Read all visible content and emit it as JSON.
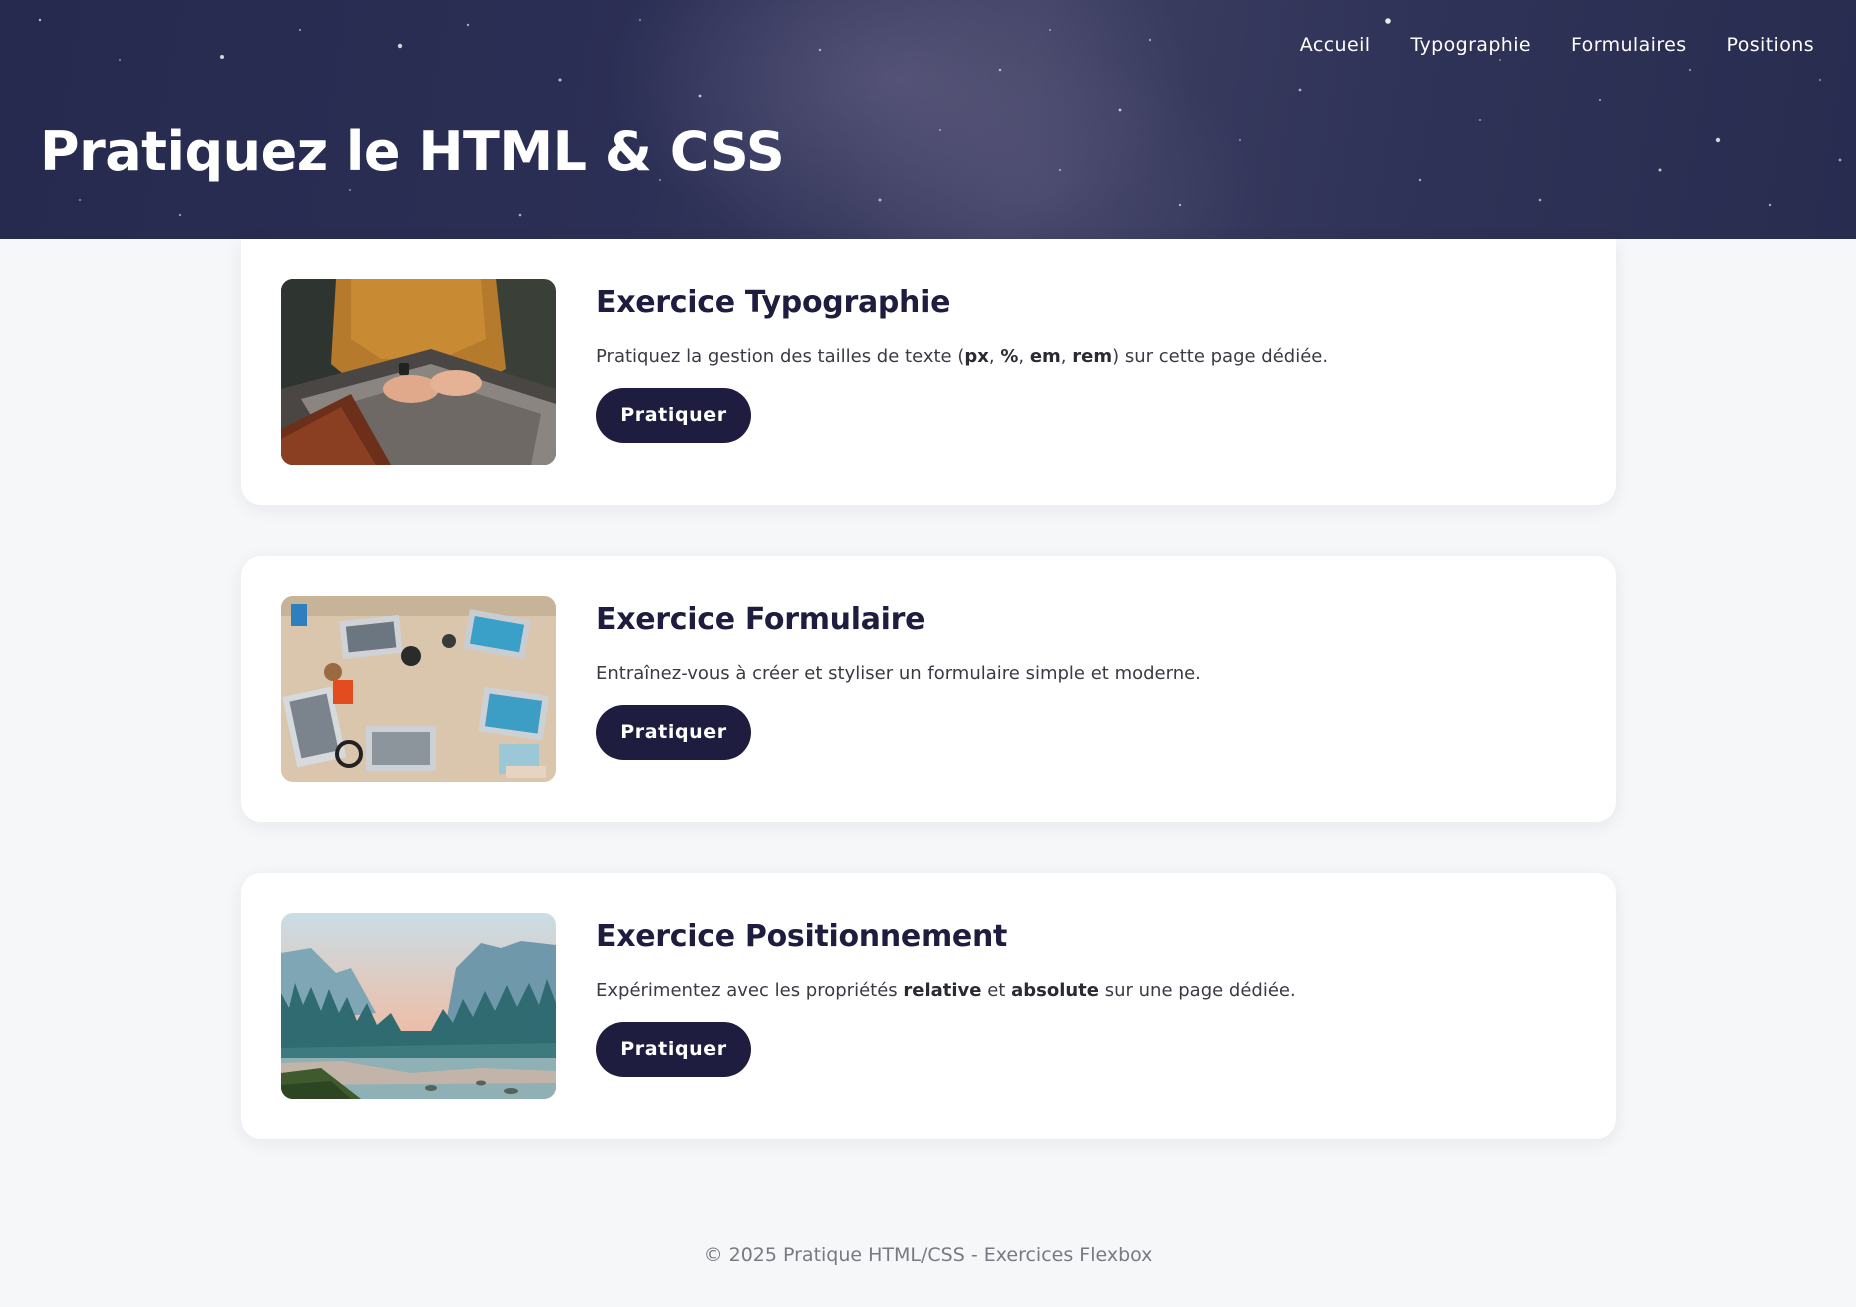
{
  "header": {
    "title": "Pratiquez le HTML & CSS",
    "nav": [
      {
        "label": "Accueil"
      },
      {
        "label": "Typographie"
      },
      {
        "label": "Formulaires"
      },
      {
        "label": "Positions"
      }
    ]
  },
  "cards": [
    {
      "title": "Exercice Typographie",
      "text_parts": [
        "Pratiquez la gestion des tailles de texte (",
        "px",
        ", ",
        "%",
        ", ",
        "em",
        ", ",
        "rem",
        ") sur cette page dédiée."
      ],
      "button": "Pratiquer",
      "image": "laptop-hands-photo"
    },
    {
      "title": "Exercice Formulaire",
      "text": "Entraînez-vous à créer et styliser un formulaire simple et moderne.",
      "button": "Pratiquer",
      "image": "desk-team-photo"
    },
    {
      "title": "Exercice Positionnement",
      "text_parts": [
        "Expérimentez avec les propriétés ",
        "relative",
        " et ",
        "absolute",
        " sur une page dédiée."
      ],
      "button": "Pratiquer",
      "image": "mountain-lake-photo"
    }
  ],
  "footer": {
    "text": "© 2025 Pratique HTML/CSS - Exercices Flexbox"
  },
  "colors": {
    "accent": "#1e1d3f",
    "page_background": "#f6f7f9",
    "hero_background": "#2c2f55"
  }
}
